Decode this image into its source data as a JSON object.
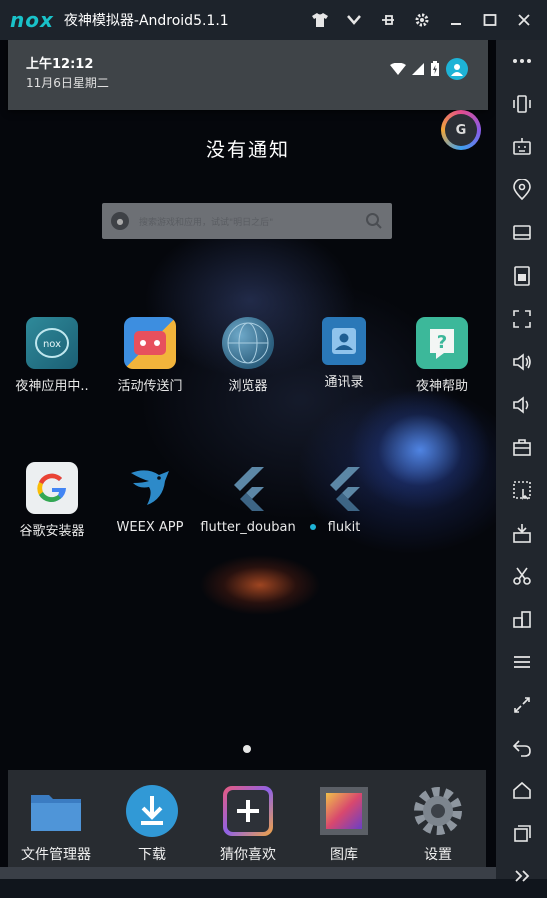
{
  "window": {
    "logo": "nox",
    "title": "夜神模拟器-Android5.1.1",
    "controls": [
      "shirt-icon",
      "chevron-down-icon",
      "pin-icon",
      "gear-icon",
      "minimize-icon",
      "maximize-icon",
      "close-icon"
    ]
  },
  "status": {
    "time": "上午12:12",
    "date": "11月6日星期二"
  },
  "notifications": {
    "empty_text": "没有通知"
  },
  "search": {
    "placeholder": "搜索游戏和应用，试试\"明日之后\""
  },
  "floating_button": {
    "letter": "G"
  },
  "apps": [
    {
      "label": "夜神应用中..",
      "icon": "nox-app-center-icon"
    },
    {
      "label": "活动传送门",
      "icon": "game-portal-icon"
    },
    {
      "label": "浏览器",
      "icon": "browser-globe-icon"
    },
    {
      "label": "通讯录",
      "icon": "contacts-icon"
    },
    {
      "label": "夜神帮助",
      "icon": "nox-help-icon"
    },
    {
      "label": "谷歌安装器",
      "icon": "google-installer-icon"
    },
    {
      "label": "WEEX APP",
      "icon": "weex-eagle-icon"
    },
    {
      "label": "flutter_douban",
      "icon": "flutter-icon"
    },
    {
      "label": "flukit",
      "icon": "flutter-icon"
    }
  ],
  "dock": [
    {
      "label": "文件管理器",
      "icon": "folder-icon"
    },
    {
      "label": "下载",
      "icon": "download-icon"
    },
    {
      "label": "猜你喜欢",
      "icon": "plus-icon"
    },
    {
      "label": "图库",
      "icon": "gallery-icon"
    },
    {
      "label": "设置",
      "icon": "settings-gear-icon"
    }
  ],
  "sidebar": [
    "more-icon",
    "shake-icon",
    "keyboard-icon",
    "location-icon",
    "screen-icon",
    "apk-icon",
    "fullscreen-icon",
    "volume-up-icon",
    "volume-down-icon",
    "toolbox-icon",
    "macro-icon",
    "install-apk-icon",
    "screenshot-scissors-icon",
    "multi-instance-icon",
    "menu-icon",
    "sync-icon",
    "back-icon",
    "home-icon",
    "recent-apps-icon",
    "expand-icon"
  ],
  "colors": {
    "accent": "#19c2c9",
    "sidebar": "#21262d",
    "titlebar": "#1d232b"
  }
}
